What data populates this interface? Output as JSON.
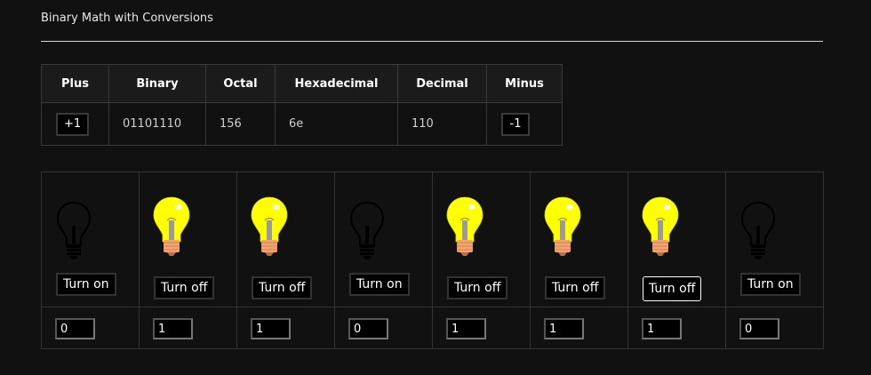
{
  "page": {
    "title": "Binary Math with Conversions"
  },
  "conversion": {
    "headers": [
      "Plus",
      "Binary",
      "Octal",
      "Hexadecimal",
      "Decimal",
      "Minus"
    ],
    "plus_label": "+1",
    "binary": "01101110",
    "octal": "156",
    "hexadecimal": "6e",
    "decimal": "110",
    "minus_label": "-1"
  },
  "bits": [
    {
      "state": "off",
      "button_label": "Turn on",
      "value": "0"
    },
    {
      "state": "on",
      "button_label": "Turn off",
      "value": "1"
    },
    {
      "state": "on",
      "button_label": "Turn off",
      "value": "1"
    },
    {
      "state": "off",
      "button_label": "Turn on",
      "value": "0"
    },
    {
      "state": "on",
      "button_label": "Turn off",
      "value": "1"
    },
    {
      "state": "on",
      "button_label": "Turn off",
      "value": "1"
    },
    {
      "state": "on",
      "button_label": "Turn off",
      "value": "1",
      "focused": true
    },
    {
      "state": "off",
      "button_label": "Turn on",
      "value": "0"
    }
  ],
  "colors": {
    "background": "#111111",
    "bulb_on": "#ffff00",
    "bulb_base": "#f4a36c",
    "bulb_off_outline": "#000000"
  },
  "icons": {
    "bulb_on": "lightbulb-on-icon",
    "bulb_off": "lightbulb-off-icon"
  }
}
